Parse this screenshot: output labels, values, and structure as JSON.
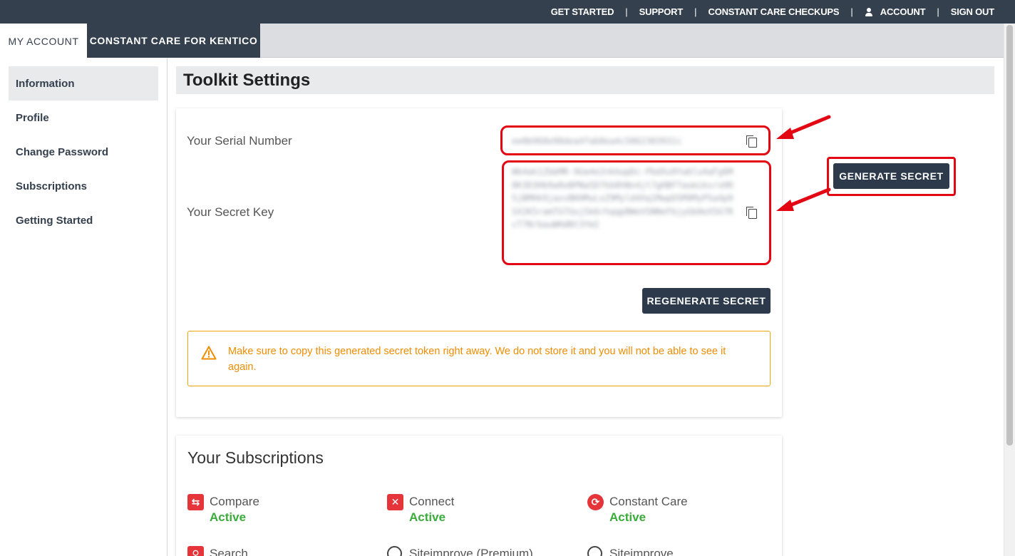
{
  "topnav": {
    "items": [
      "GET STARTED",
      "SUPPORT",
      "CONSTANT CARE CHECKUPS",
      "ACCOUNT",
      "SIGN OUT"
    ],
    "separator": "|",
    "account_icon": "user-icon"
  },
  "tabs": [
    {
      "label": "MY ACCOUNT",
      "active": true
    },
    {
      "label": "CONSTANT CARE FOR KENTICO",
      "active": false
    }
  ],
  "sidebar": {
    "items": [
      {
        "label": "Information",
        "active": true
      },
      {
        "label": "Profile",
        "active": false
      },
      {
        "label": "Change Password",
        "active": false
      },
      {
        "label": "Subscriptions",
        "active": false
      },
      {
        "label": "Getting Started",
        "active": false
      }
    ]
  },
  "page": {
    "title": "Toolkit Settings"
  },
  "settings": {
    "serial_label": "Your Serial Number",
    "serial_value": "ee0b968e98dea4fab8ea4c5062303931c",
    "secret_label": "Your Secret Key",
    "secret_value": "Wb4ak1ZbbMR-9Ua4e2nkkwpDc-PbdXu9Ywblu4aFg6M8K3D3Hb9a0oBPNa5D7kb8hNn4jt7gHBFTaomiksrxHH5jBMHk9jaxvBKHMuLxZ9Myld4Xq1MwpD5M9MyP5a4p9SX2K5ramTU7Uuj5k6rhqqpBWeVSNNeFbjyGb8eX5G7RcT7NrbauWHdNt3YmI",
    "copy_icon": "copy-icon",
    "regenerate_label": "REGENERATE SECRET",
    "generate_label": "GENERATE SECRET",
    "warning_icon": "warning-icon",
    "warning_text": "Make sure to copy this generated secret token right away. We do not store it and you will not be able to see it again."
  },
  "subscriptions": {
    "title": "Your Subscriptions",
    "items": [
      {
        "name": "Compare",
        "status": "Active",
        "icon": "compare-icon"
      },
      {
        "name": "Connect",
        "status": "Active",
        "icon": "connect-icon"
      },
      {
        "name": "Constant Care",
        "status": "Active",
        "icon": "constant-care-icon"
      },
      {
        "name": "Search",
        "status": "",
        "icon": "search-icon"
      },
      {
        "name": "Siteimprove (Premium)",
        "status": "",
        "icon": "siteimprove-icon"
      },
      {
        "name": "Siteimprove",
        "status": "",
        "icon": "siteimprove-icon"
      }
    ]
  },
  "colors": {
    "topbar": "#35404e",
    "button_dark": "#2c3a4b",
    "highlight": "#e30613",
    "warning": "#f08c00",
    "active_status": "#3aac3a",
    "sub_icon": "#e5343a"
  }
}
